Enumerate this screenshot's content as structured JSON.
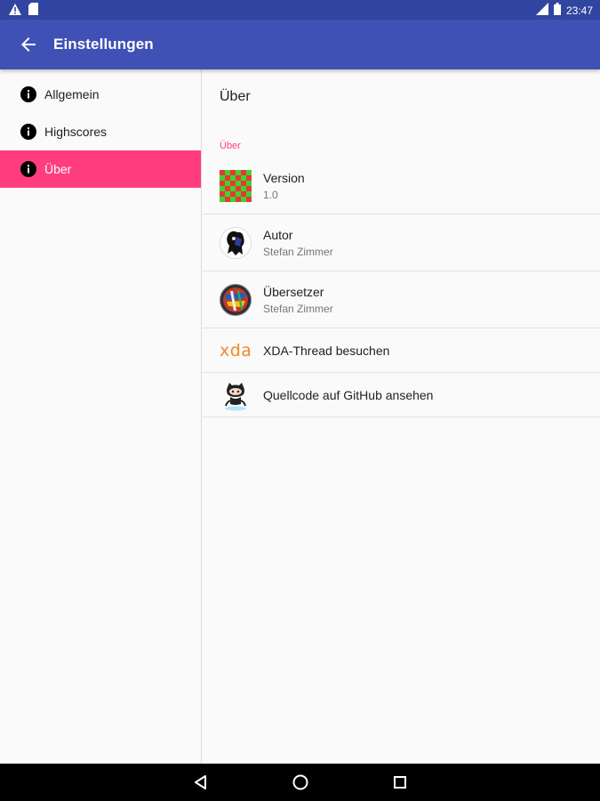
{
  "status_bar": {
    "time": "23:47",
    "icons": [
      "warning-icon",
      "sd-card-icon",
      "signal-icon",
      "battery-icon"
    ]
  },
  "app_bar": {
    "title": "Einstellungen",
    "back_icon": "arrow-back-icon"
  },
  "sidebar": {
    "items": [
      {
        "label": "Allgemein",
        "icon": "info-icon",
        "active": false
      },
      {
        "label": "Highscores",
        "icon": "info-icon",
        "active": false
      },
      {
        "label": "Über",
        "icon": "info-icon",
        "active": true
      }
    ]
  },
  "content": {
    "header": "Über",
    "section_label": "Über",
    "prefs": [
      {
        "title": "Version",
        "summary": "1.0",
        "icon": "checkerboard-icon"
      },
      {
        "title": "Autor",
        "summary": "Stefan Zimmer",
        "icon": "author-avatar-icon"
      },
      {
        "title": "Übersetzer",
        "summary": "Stefan Zimmer",
        "icon": "translator-avatar-icon"
      },
      {
        "title": "XDA-Thread besuchen",
        "icon": "xda-logo-icon",
        "logo_text": "xda"
      },
      {
        "title": "Quellcode auf GitHub ansehen",
        "icon": "github-octocat-icon"
      }
    ]
  },
  "nav_bar": {
    "icons": [
      "back-triangle-icon",
      "home-circle-icon",
      "recents-square-icon"
    ]
  },
  "colors": {
    "primary": "#3f51b5",
    "primary_dark": "#3145a0",
    "accent": "#ff3d7f",
    "background": "#fafafa"
  }
}
